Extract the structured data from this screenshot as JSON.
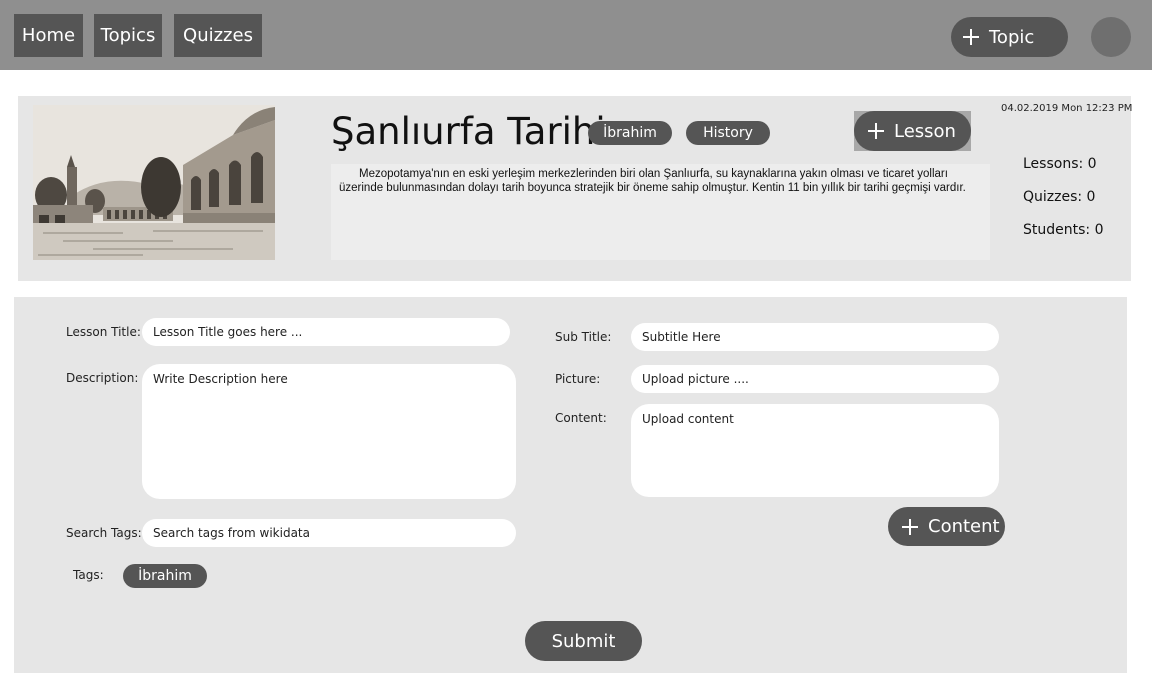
{
  "nav": {
    "home": "Home",
    "topics": "Topics",
    "quizzes": "Quizzes",
    "add_topic": "Topic"
  },
  "topic": {
    "title": "Şanlıurfa Tarihi",
    "tags": [
      "İbrahim",
      "History"
    ],
    "add_lesson": "Lesson",
    "datetime": "04.02.2019 Mon 12:23 PM",
    "description": "Mezopotamya'nın en eski yerleşim merkezlerinden biri olan Şanlıurfa, su kaynaklarına yakın olması ve ticaret yolları üzerinde bulunmasından dolayı tarih boyunca stratejik bir öneme sahip olmuştur. Kentin 11 bin yıllık bir tarihi geçmişi vardır.",
    "stats": {
      "lessons": "Lessons: 0",
      "quizzes": "Quizzes: 0",
      "students": "Students: 0"
    }
  },
  "form": {
    "lesson_title_label": "Lesson Title:",
    "lesson_title_value": "Lesson Title goes here ...",
    "description_label": "Description:",
    "description_value": "Write Description here",
    "search_tags_label": "Search Tags:",
    "search_tags_value": "Search tags from wikidata",
    "tags_label": "Tags:",
    "tags": [
      "İbrahim"
    ],
    "subtitle_label": "Sub Title:",
    "subtitle_value": "Subtitle Here",
    "picture_label": "Picture:",
    "picture_value": "Upload picture ....",
    "content_label": "Content:",
    "content_value": "Upload content",
    "add_content": "Content",
    "submit": "Submit"
  },
  "colors": {
    "topbar": "#8f8f8f",
    "button": "#555555",
    "panel": "#e6e6e6"
  }
}
